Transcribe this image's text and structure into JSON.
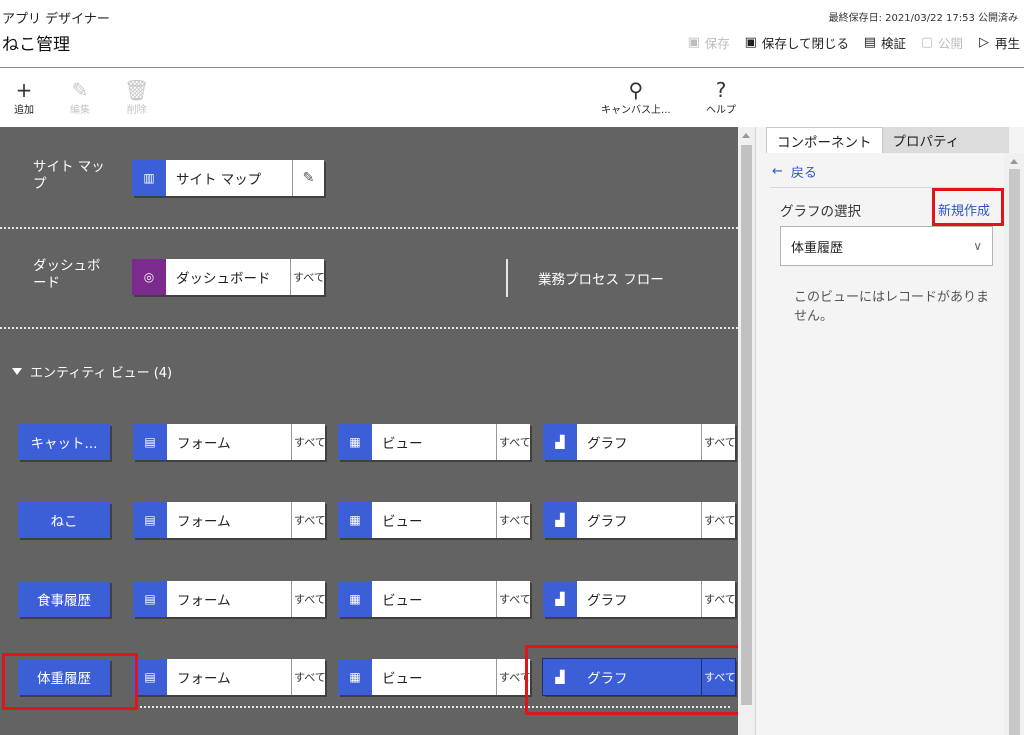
{
  "header": {
    "app_name": "アプリ デザイナー",
    "app_title": "ねこ管理",
    "last_saved": "最終保存日: 2021/03/22 17:53 公開済み",
    "actions": {
      "save": "保存",
      "save_close": "保存して閉じる",
      "validate": "検証",
      "publish": "公開",
      "play": "再生"
    }
  },
  "commandbar": {
    "add": "追加",
    "edit": "編集",
    "delete": "削除",
    "canvas_search": "キャンバス上...",
    "help": "ヘルプ"
  },
  "canvas": {
    "sitemap": {
      "label": "サイト マップ",
      "tile_label": "サイト マップ"
    },
    "dashboard": {
      "label": "ダッシュボード",
      "tile_label": "ダッシュボード",
      "all": "すべて"
    },
    "bpf_label": "業務プロセス フロー",
    "entity_view_header": "エンティティ ビュー (4)",
    "component_labels": {
      "form": "フォーム",
      "view": "ビュー",
      "chart": "グラフ",
      "all": "すべて"
    },
    "entities": [
      {
        "name": "キャット..."
      },
      {
        "name": "ねこ"
      },
      {
        "name": "食事履歴"
      },
      {
        "name": "体重履歴"
      }
    ]
  },
  "panel": {
    "tabs": {
      "components": "コンポーネント",
      "properties": "プロパティ"
    },
    "back": "戻る",
    "chart_select_label": "グラフの選択",
    "new_link": "新規作成",
    "selected_value": "体重履歴",
    "empty_message": "このビューにはレコードがありません。"
  },
  "colors": {
    "canvas_bg": "#636363",
    "accent_blue": "#3c5ed6",
    "dashboard_purple": "#7d2a8f",
    "link_blue": "#2b56c4",
    "callout_red": "#e0151b"
  }
}
